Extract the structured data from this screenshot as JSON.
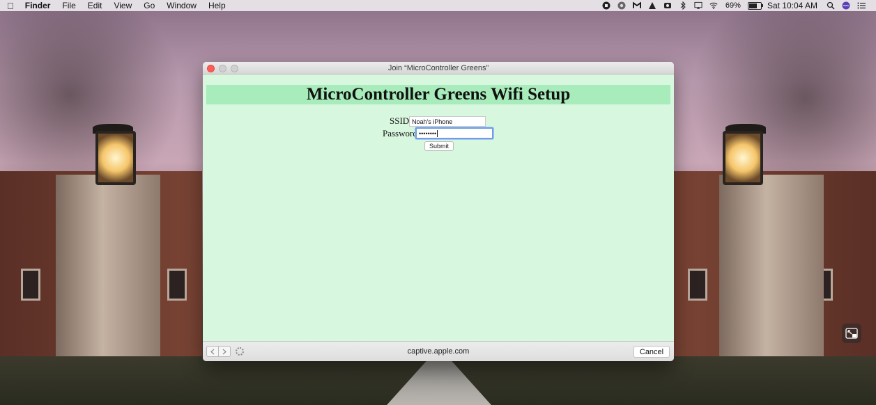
{
  "menubar": {
    "app_name": "Finder",
    "menus": [
      "File",
      "Edit",
      "View",
      "Go",
      "Window",
      "Help"
    ],
    "battery_percent": "69%",
    "battery_level": 0.69,
    "clock": "Sat 10:04 AM",
    "status_icons": [
      "screen-record-icon",
      "chrome-icon",
      "gmail-icon",
      "vlc-icon",
      "camera-icon",
      "bluetooth-icon",
      "airplay-icon",
      "wifi-icon",
      "battery-icon",
      "spotlight-icon",
      "siri-icon",
      "notification-center-icon"
    ]
  },
  "window": {
    "title": "Join “MicroController Greens”",
    "page": {
      "heading": "MicroController Greens Wifi Setup",
      "ssid_label": "SSID",
      "ssid_value": "Noah's iPhone",
      "password_label": "Password",
      "password_value": "••••••••",
      "submit_label": "Submit"
    },
    "url": "captive.apple.com",
    "cancel_label": "Cancel"
  },
  "colors": {
    "page_background": "#d8f7df",
    "banner_background": "#a7ecba",
    "focus_ring": "#6f9fe3",
    "close_button": "#fc5f57"
  }
}
